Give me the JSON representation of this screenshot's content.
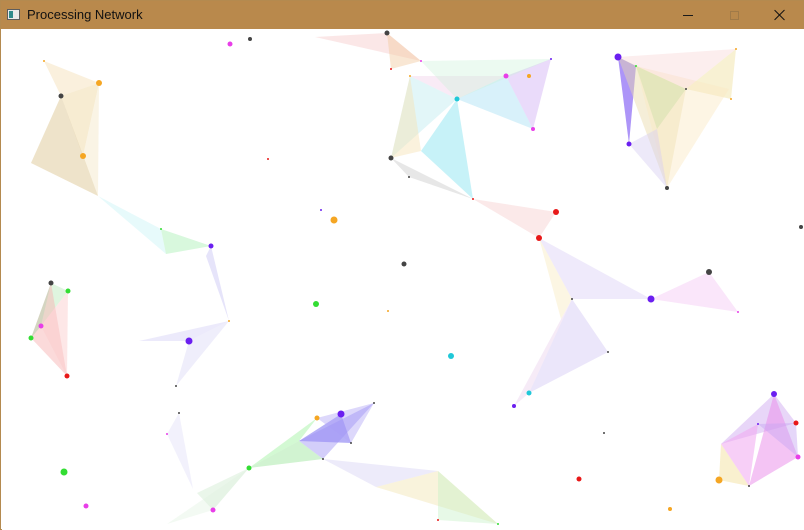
{
  "window": {
    "title": "Processing Network",
    "icon": "processing-app-icon",
    "controls": [
      "minimize-icon",
      "maximize-icon",
      "close-icon"
    ]
  },
  "palette": {
    "titlebar": "#b9894c",
    "dark": "#444444",
    "orange": "#f5a623",
    "magenta": "#e83ee8",
    "green": "#33dd33",
    "red": "#e81818",
    "blue": "#6b1ff0",
    "cyan": "#20c8d8"
  }
}
